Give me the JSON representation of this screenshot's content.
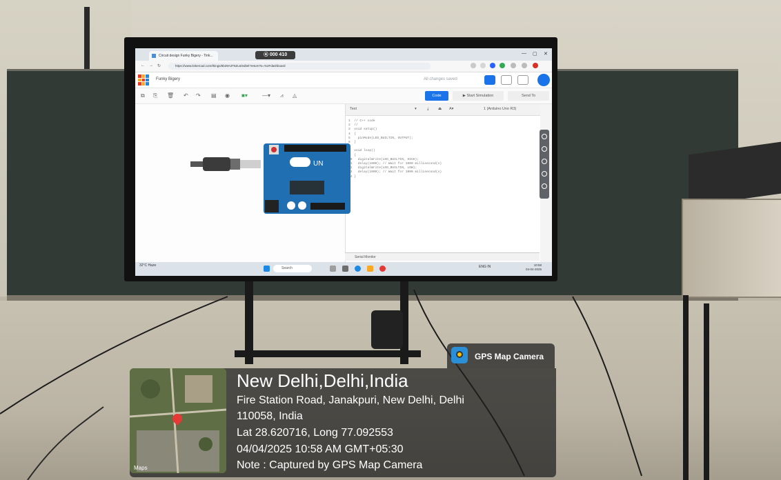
{
  "screen": {
    "rec_counter": "000 410",
    "project_name": "Funky Bigery",
    "save_status": "All changes saved",
    "toolbar": {
      "code_label": "Code",
      "start_simulation_label": "Start Simulation",
      "send_to_label": "Send To"
    },
    "code_panel": {
      "mode": "Text",
      "device": "1 (Arduino Uno R3)",
      "lines": [
        "1  // C++ code",
        "2  //",
        "3  void setup()",
        "4  {",
        "5    pinMode(LED_BUILTIN, OUTPUT);",
        "6  }",
        "7",
        "8  void loop()",
        "9  {",
        "10   digitalWrite(LED_BUILTIN, HIGH);",
        "11   delay(1000); // Wait for 1000 millisecond(s)",
        "12   digitalWrite(LED_BUILTIN, LOW);",
        "13   delay(1000); // Wait for 1000 millisecond(s)",
        "14 }"
      ],
      "serial_monitor_label": "Serial Monitor"
    },
    "taskbar": {
      "weather": "32°C Haze",
      "search_placeholder": "Search",
      "clock_time": "10:58",
      "clock_date": "04-04-2025",
      "lang": "ENG IN"
    }
  },
  "gps_overlay": {
    "app_name": "GPS Map Camera",
    "city": "New Delhi,Delhi,India",
    "address_line1": "Fire Station Road, Janakpuri, New Delhi, Delhi",
    "address_line2": "110058, India",
    "coordinates": "Lat 28.620716, Long 77.092553",
    "datetime": "04/04/2025 10:58 AM GMT+05:30",
    "note": "Note : Captured by GPS Map Camera",
    "map_label": "Maps"
  },
  "colors": {
    "accent": "#1a73e8",
    "board": "#1f6fb2",
    "overlay": "#1e1e1e"
  }
}
